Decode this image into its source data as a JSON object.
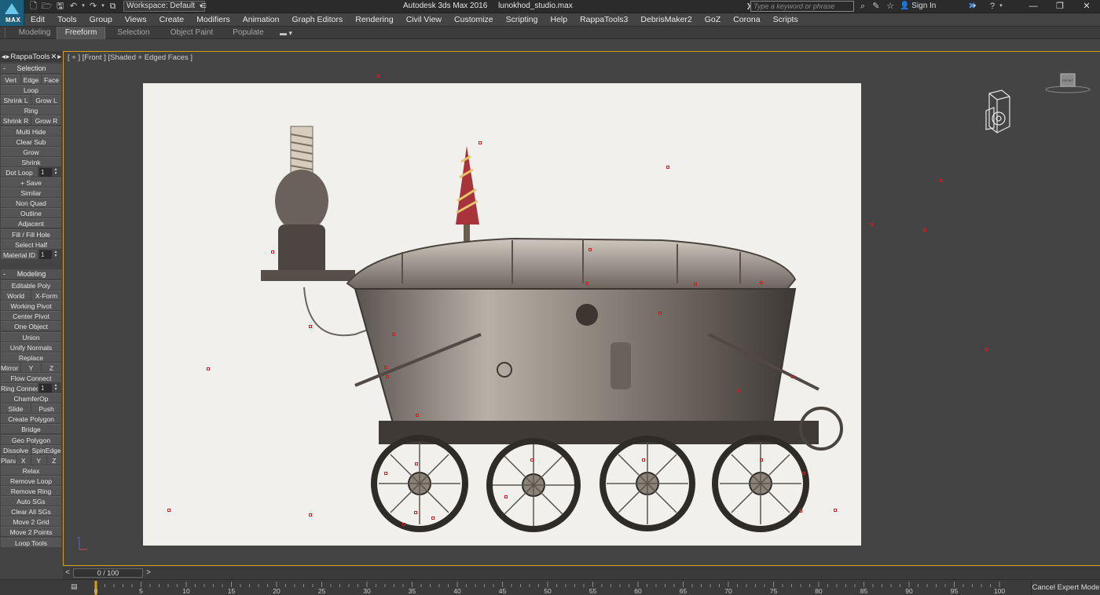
{
  "app": {
    "logo_text": "MAX",
    "window_title": "Autodesk 3ds Max 2016     lunokhod_studio.max",
    "workspace": "Workspace: Default",
    "search_placeholder": "Type a keyword or phrase",
    "signin_label": "Sign In"
  },
  "menu": [
    "Edit",
    "Tools",
    "Group",
    "Views",
    "Create",
    "Modifiers",
    "Animation",
    "Graph Editors",
    "Rendering",
    "Civil View",
    "Customize",
    "Scripting",
    "Help",
    "RappaTools3",
    "DebrisMaker2",
    "GoZ",
    "Corona",
    "Scripts"
  ],
  "ribbon": {
    "tabs": [
      "Modeling",
      "Freeform",
      "Selection",
      "Object Paint",
      "Populate"
    ],
    "active_tab": "Freeform"
  },
  "panel": {
    "title": "RappaTools",
    "selection_title": "Selection",
    "modeling_title": "Modeling",
    "selection_rows": [
      [
        "Vert",
        "Edge",
        "Face"
      ],
      [
        "Loop"
      ],
      [
        "Shrink L",
        "Grow L"
      ],
      [
        "Ring"
      ],
      [
        "Shrink R",
        "Grow R"
      ],
      [
        "Multi Hide"
      ],
      [
        "Clear Sub"
      ],
      [
        "Grow"
      ],
      [
        "Shrink"
      ],
      [
        "Dot Loop"
      ],
      [
        "+ Save"
      ],
      [
        "Similar"
      ],
      [
        "Non Quad"
      ],
      [
        "Outline"
      ],
      [
        "Adjacent"
      ],
      [
        "Fill / Fill Hole"
      ],
      [
        "Select Half"
      ],
      [
        "Material ID"
      ]
    ],
    "dot_loop_value": "1",
    "material_id_value": "1",
    "modeling_rows": [
      [
        "Editable Poly"
      ],
      [
        "World",
        "X-Form"
      ],
      [
        "Working Pivot"
      ],
      [
        "Center Pivot"
      ],
      [
        "One Object"
      ],
      [
        "Union"
      ],
      [
        "Unify Normals"
      ],
      [
        "Replace"
      ],
      [
        "Mirror X",
        "Y",
        "Z"
      ],
      [
        "Flow Connect"
      ],
      [
        "Ring Connect"
      ],
      [
        "ChamferOp"
      ],
      [
        "Slide",
        "Push"
      ],
      [
        "Create Polygon"
      ],
      [
        "Bridge"
      ],
      [
        "Geo Polygon"
      ],
      [
        "Dissolve",
        "SpinEdge"
      ],
      [
        "Planar",
        "X",
        "Y",
        "Z"
      ],
      [
        "Relax"
      ],
      [
        "Remove Loop"
      ],
      [
        "Remove Ring"
      ],
      [
        "Auto SGs"
      ],
      [
        "Clear All SGs"
      ],
      [
        "Move 2 Grid"
      ],
      [
        "Move 2 Points"
      ],
      [
        "Loop Tools"
      ]
    ],
    "ring_connect_value": "1"
  },
  "viewport": {
    "label": "[ + ] [Front ] [Shaded + Edged Faces ]"
  },
  "timeline": {
    "slider_text": "0 / 100",
    "frame_labels": [
      "0",
      "5",
      "10",
      "15",
      "20",
      "25",
      "30",
      "35",
      "40",
      "45",
      "50",
      "55",
      "60",
      "65",
      "70",
      "75",
      "80",
      "85",
      "90",
      "95",
      "100"
    ],
    "current_frame": 0,
    "total_frames": 100,
    "expert_mode_label": "Cancel Expert Mode"
  },
  "colors": {
    "viewport_border": "#d4a017",
    "vertex": "#d51b1b",
    "accent": "#1b5f7c"
  }
}
